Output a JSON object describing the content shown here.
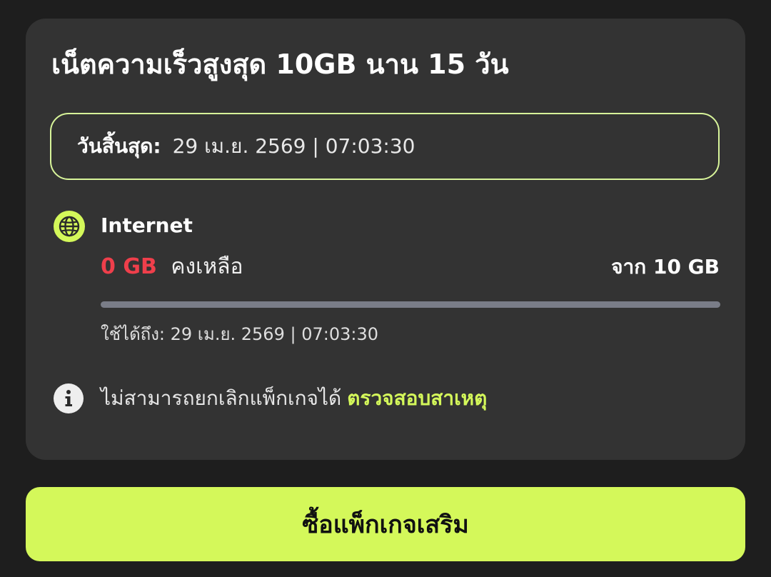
{
  "package": {
    "title": "เน็ตความเร็วสูงสุด 10GB นาน 15 วัน",
    "expiry_label": "วันสิ้นสุด:",
    "expiry_value": "29 เม.ย. 2569 | 07:03:30"
  },
  "internet": {
    "icon": "globe-icon",
    "name": "Internet",
    "remaining_amount": "0 GB",
    "remaining_label": "คงเหลือ",
    "total": "จาก 10 GB",
    "remaining_fraction": 0,
    "valid_until": "ใช้ได้ถึง: 29 เม.ย. 2569 | 07:03:30"
  },
  "notice": {
    "icon": "info-icon",
    "text": "ไม่สามารถยกเลิกแพ็กเกจได้",
    "link_label": "ตรวจสอบสาเหตุ"
  },
  "actions": {
    "buy_label": "ซื้อแพ็กเกจเสริม"
  },
  "colors": {
    "accent": "#d4f85a",
    "alert": "#ef3f4b",
    "card_bg": "#333333",
    "page_bg": "#1e1e1e",
    "expiry_border": "#d8f59a",
    "progress_track": "#7a7d88"
  }
}
